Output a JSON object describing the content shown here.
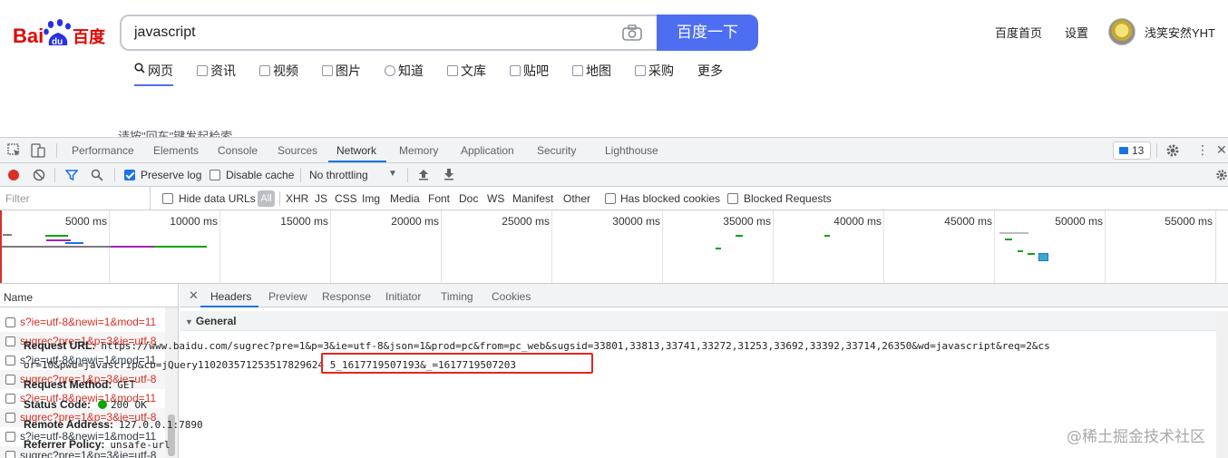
{
  "baidu": {
    "logo_text_left": "Bai",
    "logo_text_du": "du",
    "logo_text_cn": "百度",
    "search_query": "javascript",
    "search_button": "百度一下",
    "links": [
      "百度首页",
      "设置"
    ],
    "username": "浅笑安然YHT",
    "nav": [
      "网页",
      "资讯",
      "视频",
      "图片",
      "知道",
      "文库",
      "贴吧",
      "地图",
      "采购",
      "更多"
    ],
    "cut_text": "请按\"回车\"键发起检索",
    "brand_color": "#4e6ef2"
  },
  "devtools": {
    "tabs": [
      "Performance",
      "Elements",
      "Console",
      "Sources",
      "Network",
      "Memory",
      "Application",
      "Security",
      "Lighthouse"
    ],
    "selected_tab": "Network",
    "issues_count": "13",
    "toolbar": {
      "preserve_log": "Preserve log",
      "disable_cache": "Disable cache",
      "throttling": "No throttling"
    },
    "filter": {
      "placeholder": "Filter",
      "hide_data_urls": "Hide data URLs",
      "all": "All",
      "types": [
        "XHR",
        "JS",
        "CSS",
        "Img",
        "Media",
        "Font",
        "Doc",
        "WS",
        "Manifest",
        "Other"
      ],
      "blocked_cookies": "Has blocked cookies",
      "blocked_requests": "Blocked Requests"
    },
    "overview_ticks": [
      "5000 ms",
      "10000 ms",
      "15000 ms",
      "20000 ms",
      "25000 ms",
      "30000 ms",
      "35000 ms",
      "40000 ms",
      "45000 ms",
      "50000 ms",
      "55000 ms"
    ],
    "name_header": "Name",
    "requests": [
      {
        "name": "s?ie=utf-8&newi=1&mod=11",
        "error": true
      },
      {
        "name": "sugrec?pre=1&p=3&ie=utf-8",
        "error": true
      },
      {
        "name": "s?ie=utf-8&newi=1&mod=11",
        "error": false
      },
      {
        "name": "sugrec?pre=1&p=3&ie=utf-8",
        "error": true
      },
      {
        "name": "s?ie=utf-8&newi=1&mod=11",
        "error": true
      },
      {
        "name": "sugrec?pre=1&p=3&ie=utf-8",
        "error": true
      },
      {
        "name": "s?ie=utf-8&newi=1&mod=11",
        "error": false
      },
      {
        "name": "sugrec?pre=1&p=3&ie=utf-8",
        "error": false
      }
    ],
    "detail_tabs": [
      "Headers",
      "Preview",
      "Response",
      "Initiator",
      "Timing",
      "Cookies"
    ],
    "general": {
      "section_title": "General",
      "request_url_label": "Request URL:",
      "request_url_line1": "https://www.baidu.com/sugrec?pre=1&p=3&ie=utf-8&json=1&prod=pc&from=pc_web&sugsid=33801,33813,33741,33272,31253,33692,33392,33714,26350&wd=javascript&req=2&cs",
      "request_url_line2": "or=10&pwd=javascrip&cb=jQuery110203571253517829624 5_1617719507193&_=1617719507203",
      "request_method_label": "Request Method:",
      "request_method": "GET",
      "status_code_label": "Status Code:",
      "status_code": "200  OK",
      "remote_address_label": "Remote Address:",
      "remote_address": "127.0.0.1:7890",
      "referrer_policy_label": "Referrer Policy:",
      "referrer_policy": "unsafe-url"
    },
    "watermark": "@稀土掘金技术社区"
  }
}
